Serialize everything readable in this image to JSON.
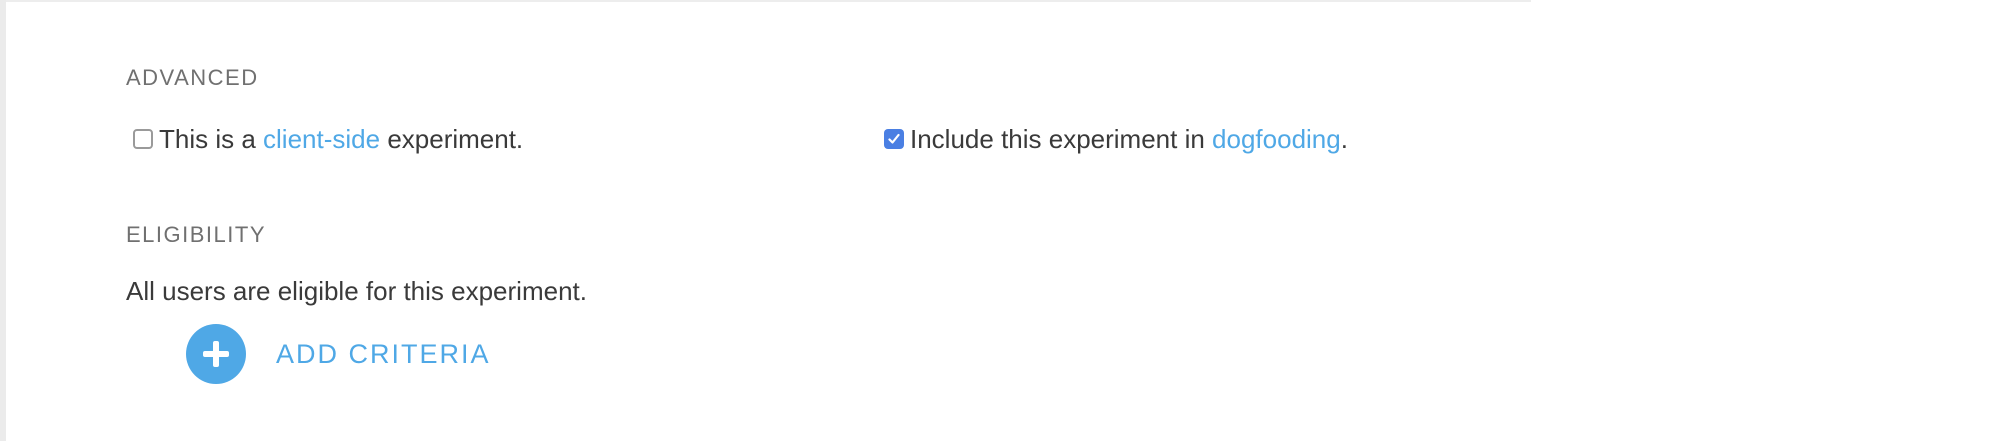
{
  "advanced": {
    "heading": "ADVANCED",
    "client_side": {
      "checked": false,
      "prefix": "This is a ",
      "link": "client-side",
      "suffix": " experiment."
    },
    "dogfooding": {
      "checked": true,
      "prefix": "Include this experiment in ",
      "link": "dogfooding",
      "suffix": "."
    }
  },
  "eligibility": {
    "heading": "ELIGIBILITY",
    "description": "All users are eligible for this experiment.",
    "add_criteria_label": "ADD CRITERIA",
    "add_icon": "plus-icon"
  },
  "colors": {
    "link": "#4fa8e6",
    "checkbox_checked": "#4a7fe3",
    "heading": "#707070",
    "text": "#3a3a3a"
  }
}
